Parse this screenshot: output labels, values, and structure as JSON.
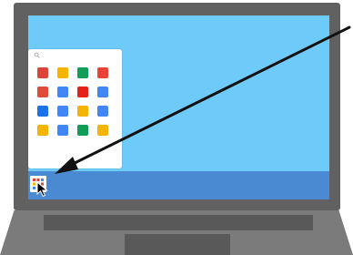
{
  "colors": {
    "laptop_frame": "#616161",
    "desktop_wallpaper": "#6ecaf9",
    "shelf": "#4a8ad3",
    "laptop_base": "#7b7b7b",
    "keyboard": "#595959",
    "panel": "#ffffff",
    "arrow": "#111111"
  },
  "shelf": {
    "launcher_icon": "app-launcher-grid-icon"
  },
  "launcher_panel": {
    "search_icon": "search-icon",
    "apps": [
      {
        "icon": "chrome-icon",
        "color": "#db4437"
      },
      {
        "icon": "web-store-icon",
        "color": "#f4b400"
      },
      {
        "icon": "drive-icon",
        "color": "#0f9d58"
      },
      {
        "icon": "gmail-icon",
        "color": "#ea4335"
      },
      {
        "icon": "google-plus-icon",
        "color": "#dd4b39"
      },
      {
        "icon": "google-plus-icon-blue",
        "color": "#4285f4"
      },
      {
        "icon": "youtube-icon",
        "color": "#e62117"
      },
      {
        "icon": "calendar-icon",
        "color": "#4285f4"
      },
      {
        "icon": "play-store-icon",
        "color": "#1a73e8"
      },
      {
        "icon": "translate-icon",
        "color": "#4285f4"
      },
      {
        "icon": "chrome-remote-icon",
        "color": "#f4b400"
      },
      {
        "icon": "docs-list-icon",
        "color": "#4285f4"
      },
      {
        "icon": "keep-icon",
        "color": "#f4b400"
      },
      {
        "icon": "docs-icon",
        "color": "#4285f4"
      },
      {
        "icon": "sheets-icon",
        "color": "#0f9d58"
      },
      {
        "icon": "slides-icon",
        "color": "#f4b400"
      }
    ]
  }
}
